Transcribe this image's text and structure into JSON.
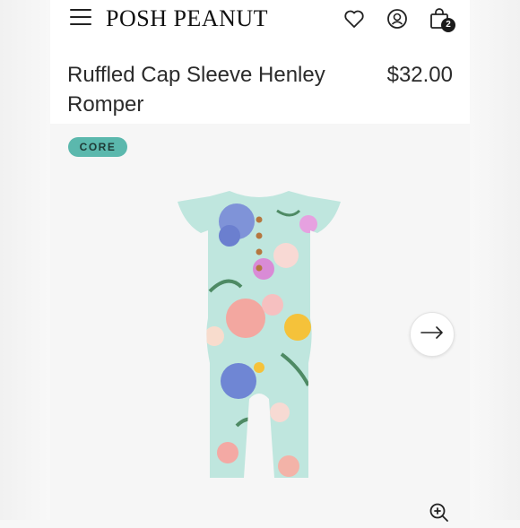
{
  "brand": {
    "name": "POSH PEANUT"
  },
  "header": {
    "menu_icon": "hamburger-menu-icon",
    "wishlist_icon": "heart-icon",
    "account_icon": "user-icon",
    "cart_icon": "shopping-bag-icon",
    "cart_count": "2"
  },
  "product": {
    "title": "Ruffled Cap Sleeve Henley Romper",
    "price": "$32.00",
    "badge": "CORE"
  },
  "gallery": {
    "next_icon": "arrow-right-icon",
    "zoom_icon": "zoom-in-icon"
  },
  "colors": {
    "badge": "#5bb8ad",
    "romper_base": "#bfe6de",
    "text": "#2b2b2b"
  }
}
